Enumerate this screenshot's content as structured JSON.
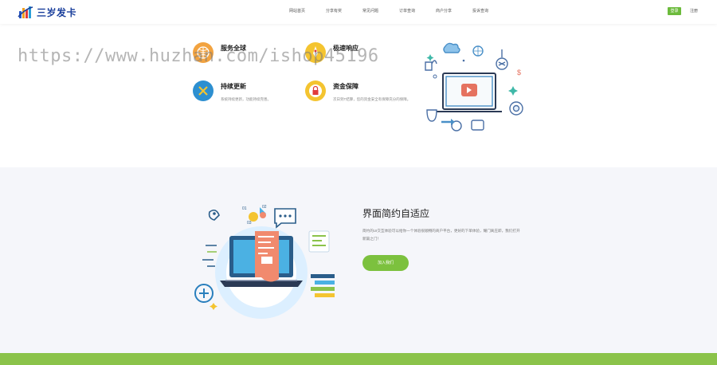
{
  "brand": {
    "name": "三岁发卡"
  },
  "nav": [
    "网站首页",
    "分享有奖",
    "常见问题",
    "订单查询",
    "商户分享",
    "投诉查询"
  ],
  "auth": {
    "login": "登录",
    "register": "注册"
  },
  "features": [
    {
      "title": "服务全球",
      "desc": ""
    },
    {
      "title": "极速响应",
      "desc": ""
    },
    {
      "title": "持续更新",
      "desc": "系统持续更新，功能持续完善。"
    },
    {
      "title": "资金保障",
      "desc": "次日到T结算，您的资金安全有保障充分的保障。"
    }
  ],
  "section2": {
    "title": "界面简约自适应",
    "desc": "简约的UI交互体验可以给你一个体验很顺畅的商户平台，更好的下单体验，耀门离庄即，我们打开新篇之门！",
    "button": "加入我们"
  },
  "watermark": "https://www.huzhan.com/ishop45196",
  "colors": {
    "accent": "#7cc13e",
    "brand": "#1a3f9c",
    "band": "#8bc34a",
    "section_bg": "#f5f6fa"
  }
}
